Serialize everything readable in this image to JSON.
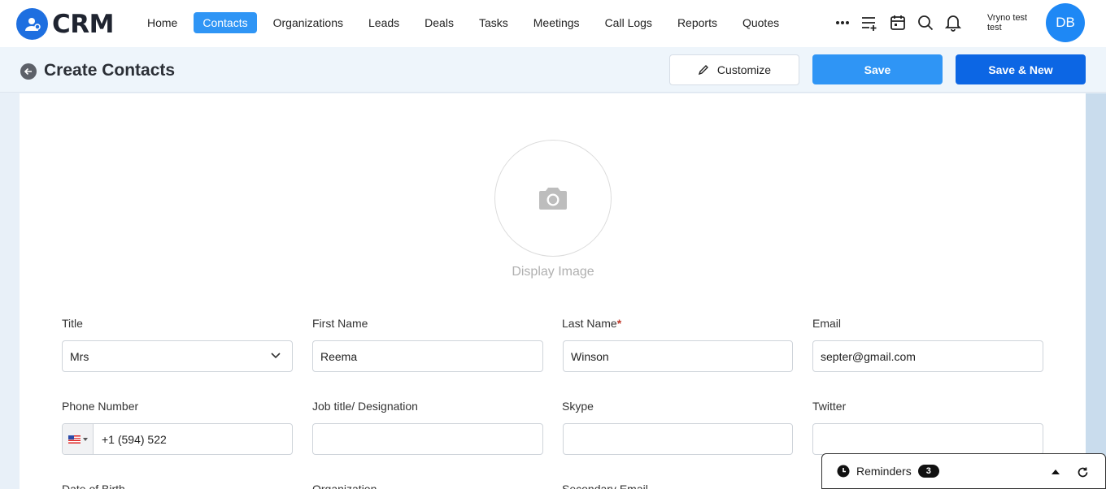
{
  "app": {
    "logo_text": "CRM"
  },
  "nav": {
    "items": [
      {
        "label": "Home",
        "active": false
      },
      {
        "label": "Contacts",
        "active": true
      },
      {
        "label": "Organizations",
        "active": false
      },
      {
        "label": "Leads",
        "active": false
      },
      {
        "label": "Deals",
        "active": false
      },
      {
        "label": "Tasks",
        "active": false
      },
      {
        "label": "Meetings",
        "active": false
      },
      {
        "label": "Call Logs",
        "active": false
      },
      {
        "label": "Reports",
        "active": false
      },
      {
        "label": "Quotes",
        "active": false
      }
    ]
  },
  "toolbar_icons": [
    "more-icon",
    "add-list-icon",
    "calendar-icon",
    "search-icon",
    "bell-icon"
  ],
  "user": {
    "name": "Vryno test test",
    "initials": "DB"
  },
  "header": {
    "title": "Create Contacts",
    "customize_label": "Customize",
    "save_label": "Save",
    "save_new_label": "Save & New"
  },
  "display_image": {
    "label": "Display Image"
  },
  "form": {
    "title": {
      "label": "Title",
      "value": "Mrs"
    },
    "first_name": {
      "label": "First Name",
      "value": "Reema"
    },
    "last_name": {
      "label": "Last Name",
      "required_mark": "*",
      "value": "Winson"
    },
    "email": {
      "label": "Email",
      "value": "septer@gmail.com"
    },
    "phone": {
      "label": "Phone Number",
      "value": "+1 (594) 522"
    },
    "job_title": {
      "label": "Job title/ Designation",
      "value": ""
    },
    "skype": {
      "label": "Skype",
      "value": ""
    },
    "twitter": {
      "label": "Twitter",
      "value": ""
    },
    "date_of_birth": {
      "label": "Date of Birth"
    },
    "organization": {
      "label": "Organization"
    },
    "secondary_email": {
      "label": "Secondary Email"
    }
  },
  "reminders": {
    "label": "Reminders",
    "count": "3"
  },
  "colors": {
    "primary": "#2f95f5",
    "primary_dark": "#0c66e4",
    "logo": "#1e6fe0"
  }
}
